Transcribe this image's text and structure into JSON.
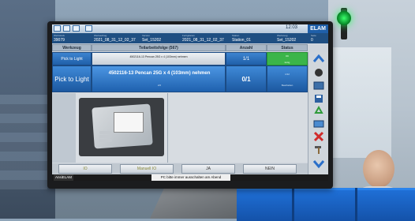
{
  "window": {
    "clock": "12:03",
    "brand": "ELAM"
  },
  "info_fields": [
    {
      "label": "Werkstück",
      "value": "39079"
    },
    {
      "label": "Werkauftrag",
      "value": "2021_08_31_12_02_37"
    },
    {
      "label": "Version",
      "value": "Set_15202"
    },
    {
      "label": "Fertigdatum",
      "value": "2021_08_31_12_02_37"
    },
    {
      "label": "Station",
      "value": "Station_01"
    },
    {
      "label": "Werkzeug",
      "value": "Set_15202"
    },
    {
      "label": "Seite",
      "value": "0"
    }
  ],
  "table": {
    "headers": [
      "Werkzeug",
      "Teilarbeitsfolge (567)",
      "Anzahl",
      "Status"
    ],
    "row1": {
      "tool": "Pick to Light",
      "task": "4502116-13 Pencan 25G x 4 (103mm) nehmen",
      "count": "1/1",
      "status_line1": "OK",
      "status_line2": "fertig"
    },
    "row2": {
      "tool": "Pick to Light",
      "task": "4502116-13 Pencan 25G x 4 (103mm) nehmen",
      "sub": "2/2",
      "count": "0/1",
      "status_line1": "1/12",
      "status_line2": "Bearbeiten"
    }
  },
  "bottom_buttons": [
    "IO",
    "Manuell IO",
    "JA",
    "NEIN"
  ],
  "status_bar": {
    "left_label": "AnsiELAM",
    "message": "PC bitte immer ausschalten am Abend"
  },
  "sidebar_icons": [
    "chevron-up-icon",
    "circle-icon",
    "monitor-icon",
    "save-icon",
    "recycle-icon",
    "card-icon",
    "close-icon",
    "hammer-icon",
    "chevron-down-icon"
  ],
  "colors": {
    "accent_blue": "#1f5fa8",
    "ok_green": "#3bb54a",
    "info_bar": "#1f4f82"
  }
}
